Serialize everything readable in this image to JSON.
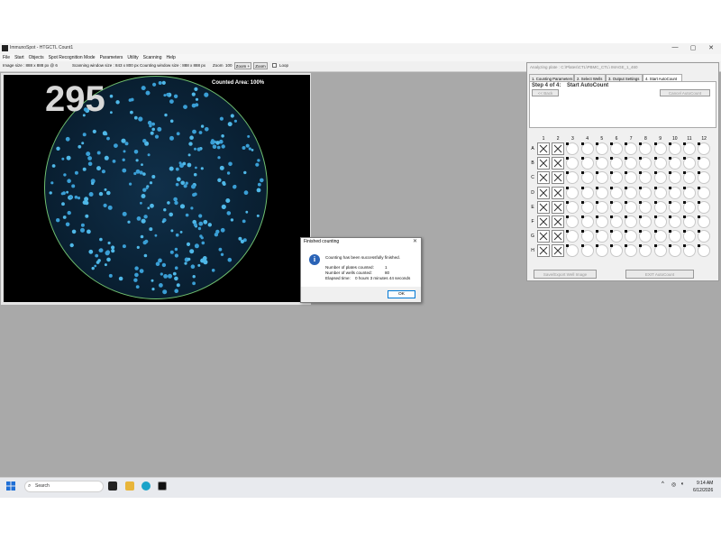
{
  "window": {
    "title": "ImmunoSpot - HTGCTL Count1",
    "controls": [
      "—",
      "▢",
      "✕"
    ]
  },
  "menu": [
    "File",
    "Start",
    "Objects",
    "Spot Recognition Mode",
    "Parameters",
    "Utility",
    "Scanning",
    "Help"
  ],
  "infobar": {
    "image_size": "Image size : 888 x 888 px @ 6",
    "scanning_window": "Scanning window size :  843 x 800 px",
    "counting_window": "Counting window size :  888 x 888 px",
    "zoom_label": "Zoom",
    "zoom_value": "100",
    "zoom_in": "Zoom +",
    "zoom_out": "Zoom -",
    "loop_label": "Loop"
  },
  "image_view": {
    "spot_count": "295",
    "counted_area": "Counted Area: 100%"
  },
  "panel": {
    "title": "Analyzing plate : C:\\Plates\\CTL\\PBMC_CTL\\ IMAGE_1_460",
    "tabs": [
      "1. Counting Parameters",
      "2. Select Wells",
      "3. Output Settings",
      "4. Start AutoCount"
    ],
    "active_tab": 3,
    "back_button": "<< Back",
    "cancel_button": "Cancel AutoCount",
    "step_label": "Step 4 of 4:",
    "step_title": "Start AutoCount",
    "columns": [
      "1",
      "2",
      "3",
      "4",
      "5",
      "6",
      "7",
      "8",
      "9",
      "10",
      "11",
      "12"
    ],
    "rows": [
      "A",
      "B",
      "C",
      "D",
      "E",
      "F",
      "G",
      "H"
    ],
    "excluded_columns": [
      "1",
      "2"
    ],
    "save_button": "Save/Export Well Image",
    "exit_button": "EXIT AutoCount"
  },
  "dialog": {
    "title": "Finished counting",
    "close": "✕",
    "message": "Counting has been successfully finished.",
    "plates_label": "Number of plates counted:",
    "plates_value": "1",
    "wells_label": "Number of wells counted:",
    "wells_value": "80",
    "elapsed_label": "Elapsed time:",
    "elapsed_value": "0 hours 3 minutes 44 seconds",
    "ok": "OK"
  },
  "taskbar": {
    "search_placeholder": "Search",
    "time": "9:14 AM",
    "date": "6/12/2026",
    "colors": {
      "start": "#1f6fd6",
      "edge": "#1aa3c9",
      "folder": "#e8b53a"
    }
  }
}
